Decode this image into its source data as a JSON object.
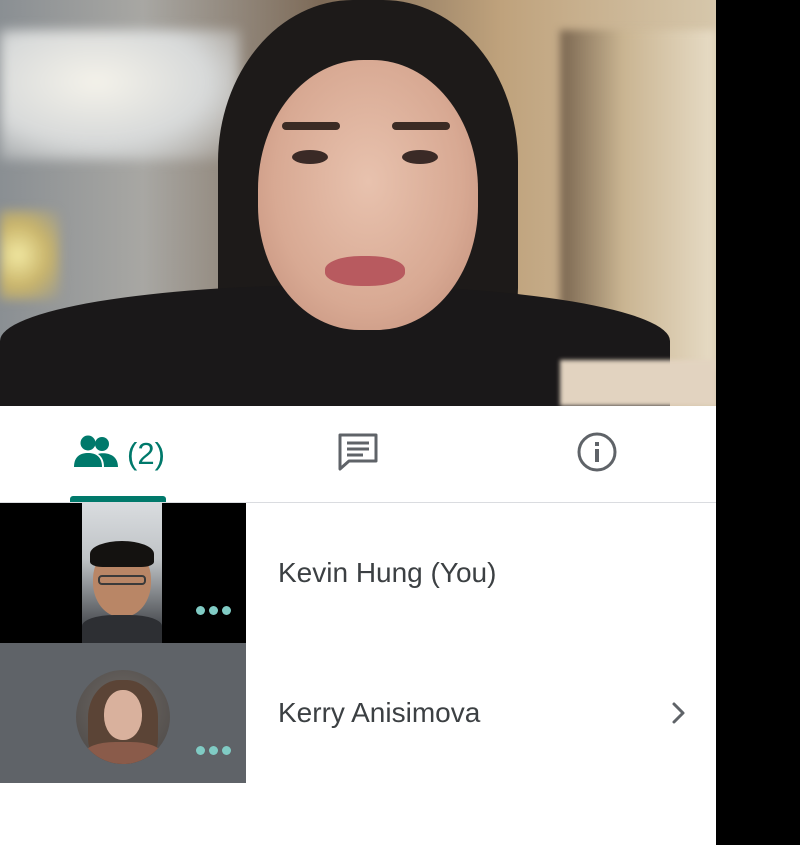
{
  "main_video": {
    "speaker_description": "main-speaker-video"
  },
  "tabs": {
    "people": {
      "icon": "people-icon",
      "count": "(2)",
      "active": true
    },
    "chat": {
      "icon": "chat-message-icon"
    },
    "info": {
      "icon": "info-icon"
    }
  },
  "participants": [
    {
      "name": "Kevin Hung (You)",
      "thumbnail": "camera-feed",
      "more_icon": "more-horiz-icon"
    },
    {
      "name": "Kerry Anisimova",
      "thumbnail": "avatar-photo",
      "more_icon": "more-horiz-icon",
      "action_icon": "chevron-right-icon"
    }
  ],
  "colors": {
    "accent": "#00796b",
    "dots": "#80cbc4",
    "text": "#3c4043",
    "icon_gray": "#5f6368",
    "divider": "#dadce0"
  }
}
